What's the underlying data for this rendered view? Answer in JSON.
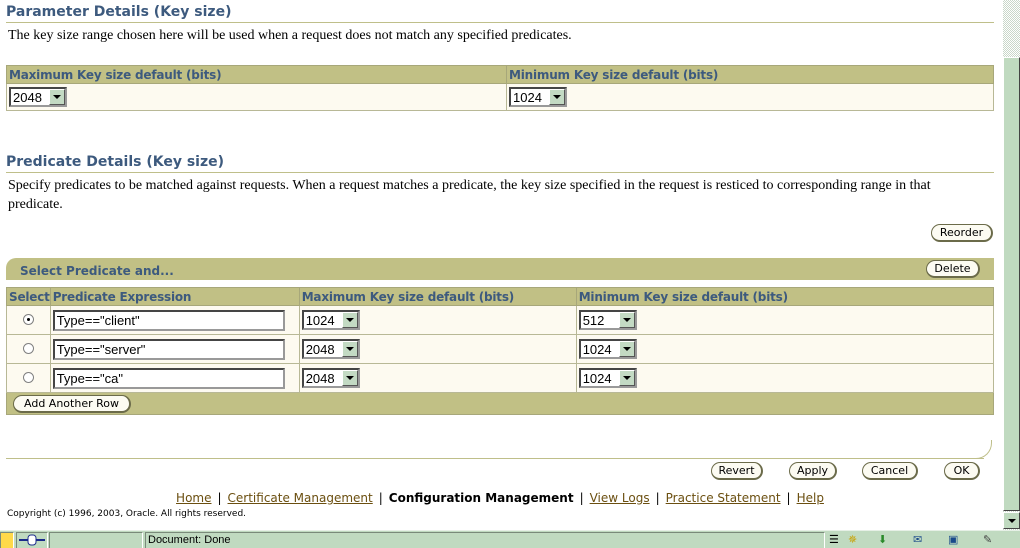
{
  "parameter_details": {
    "title": "Parameter Details (Key size)",
    "description": "The key size range chosen here will be used when a request does not match any specified predicates.",
    "columns": [
      "Maximum Key size default (bits)",
      "Minimum Key size default (bits)"
    ],
    "max_default": "2048",
    "min_default": "1024"
  },
  "predicate_details": {
    "title": "Predicate Details (Key size)",
    "description": "Specify predicates to be matched against requests. When a request matches a predicate, the key size specified in the request is resticed to corresponding range in that predicate.",
    "reorder_label": "Reorder",
    "bar_title": "Select Predicate and...",
    "delete_label": "Delete",
    "columns": [
      "Select",
      "Predicate Expression",
      "Maximum Key size default (bits)",
      "Minimum Key size default (bits)"
    ],
    "rows": [
      {
        "selected": true,
        "expression": "Type==\"client\"",
        "max": "1024",
        "min": "512"
      },
      {
        "selected": false,
        "expression": "Type==\"server\"",
        "max": "2048",
        "min": "1024"
      },
      {
        "selected": false,
        "expression": "Type==\"ca\"",
        "max": "2048",
        "min": "1024"
      }
    ],
    "add_row_label": "Add Another Row"
  },
  "actions": {
    "revert": "Revert",
    "apply": "Apply",
    "cancel": "Cancel",
    "ok": "OK"
  },
  "footer": {
    "links": [
      {
        "label": "Home",
        "current": false
      },
      {
        "label": "Certificate Management",
        "current": false
      },
      {
        "label": "Configuration Management",
        "current": true
      },
      {
        "label": "View Logs",
        "current": false
      },
      {
        "label": "Practice Statement",
        "current": false
      },
      {
        "label": "Help",
        "current": false
      }
    ],
    "separator": "|",
    "copyright": "Copyright (c) 1996, 2003, Oracle. All rights reserved."
  },
  "statusbar": {
    "text": "Document: Done",
    "icons": [
      "lock-icon",
      "connection-icon",
      "menu-icon",
      "navigator-icon",
      "download-icon",
      "chat-icon",
      "addressbook-icon",
      "composer-icon"
    ]
  },
  "colors": {
    "header_bg": "#c1c085",
    "title_text": "#3d5a7e",
    "cell_bg": "#fdfaf0",
    "link": "#6b4f10",
    "chrome": "#c0dac0"
  }
}
